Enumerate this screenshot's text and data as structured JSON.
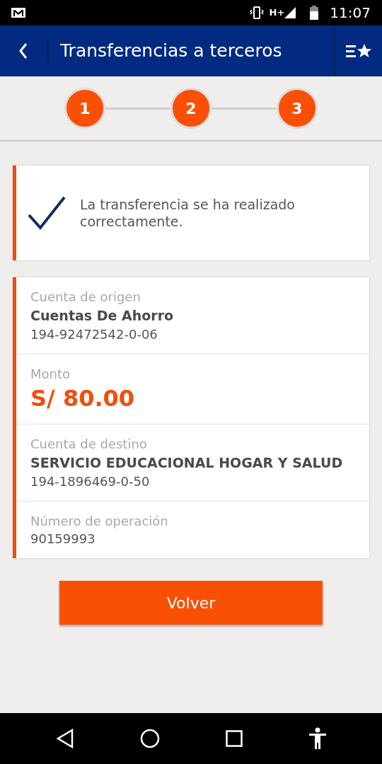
{
  "status_bar": {
    "network": "H+",
    "time": "11:07"
  },
  "header": {
    "title": "Transferencias a terceros"
  },
  "steps": [
    {
      "label": "1",
      "done": true
    },
    {
      "label": "2",
      "done": true
    },
    {
      "label": "3",
      "done": true
    }
  ],
  "message": {
    "text": "La transferencia se ha realizado correctamente."
  },
  "details": [
    {
      "kind": "account",
      "label": "Cuenta de origen",
      "name": "Cuentas De Ahorro",
      "number": "194-92472542-0-06"
    },
    {
      "kind": "amount",
      "label": "Monto",
      "value": "S/ 80.00"
    },
    {
      "kind": "account",
      "label": "Cuenta de destino",
      "name": "SERVICIO EDUCACIONAL HOGAR Y SALUD",
      "number": "194-1896469-0-50"
    },
    {
      "kind": "plain",
      "label": "Número de operación",
      "value": "90159993"
    }
  ],
  "button": {
    "label": "Volver"
  }
}
